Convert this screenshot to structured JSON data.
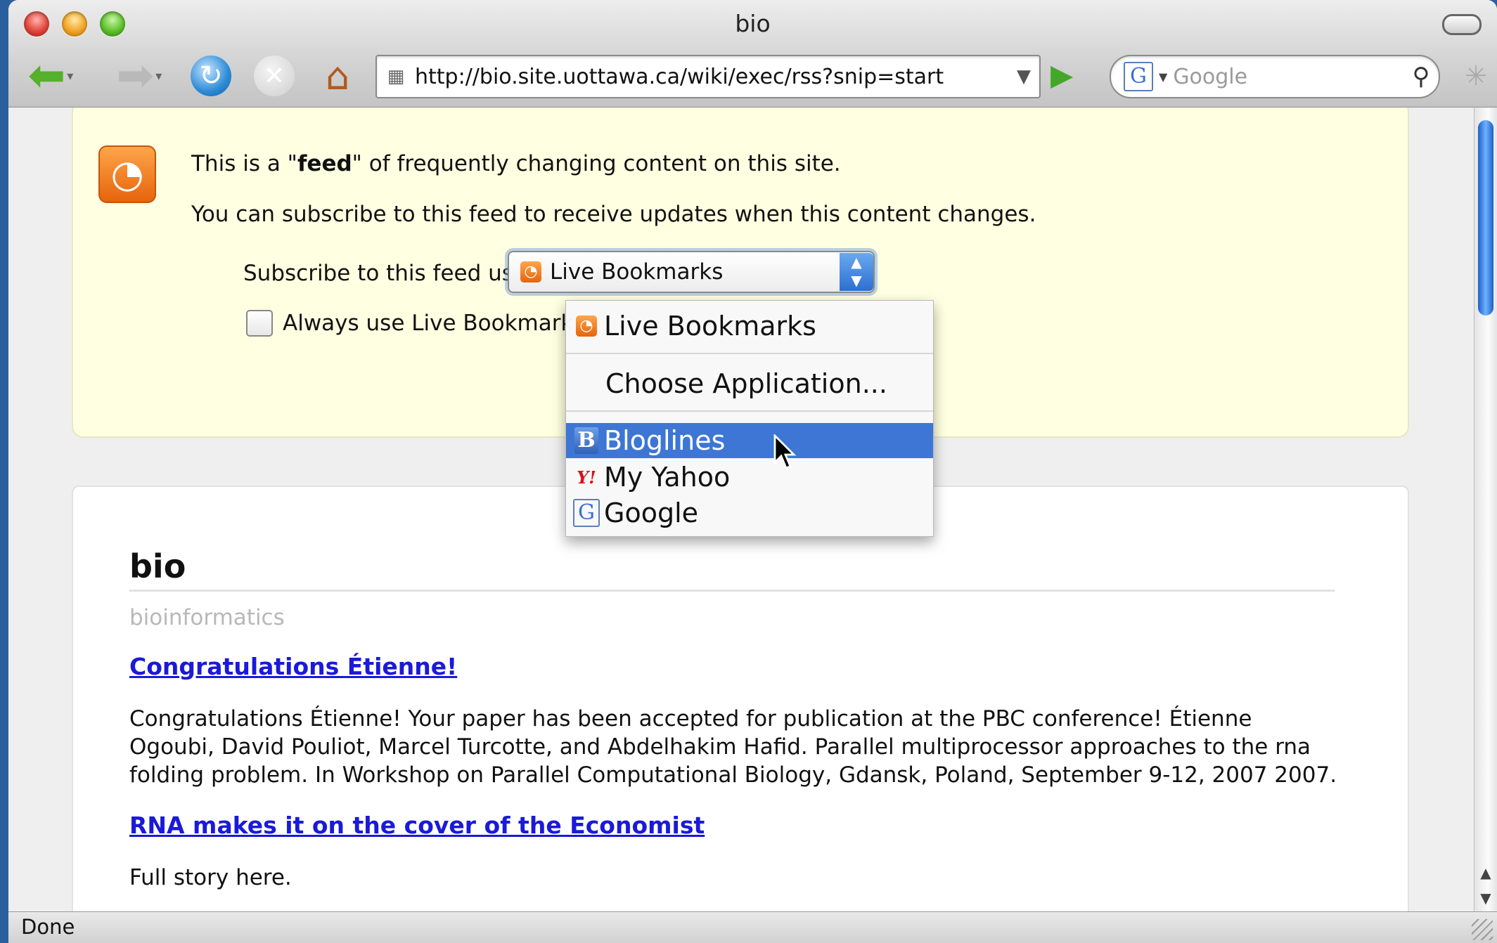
{
  "window": {
    "title": "bio"
  },
  "toolbar": {
    "back_icon": "back-arrow-icon",
    "forward_icon": "forward-arrow-icon",
    "url": "http://bio.site.uottawa.ca/wiki/exec/rss?snip=start",
    "search_engine_letter": "G",
    "search_placeholder": "Google"
  },
  "feed": {
    "line1_pre": "This is a \"",
    "line1_bold": "feed",
    "line1_post": "\" of frequently changing content on this site.",
    "line2": "You can subscribe to this feed to receive updates when this content changes.",
    "subscribe_label": "Subscribe to this feed using",
    "selected_reader": "Live Bookmarks",
    "always_use_label": "Always use Live Bookmark",
    "always_use_checked": false
  },
  "dropdown": {
    "options": [
      {
        "label": "Live Bookmarks",
        "icon": "rss-icon"
      },
      {
        "label": "Choose Application...",
        "icon": ""
      },
      {
        "label": "Bloglines",
        "icon": "bloglines-icon",
        "highlighted": true
      },
      {
        "label": "My Yahoo",
        "icon": "yahoo-icon"
      },
      {
        "label": "Google",
        "icon": "google-icon"
      }
    ]
  },
  "article": {
    "site_title": "bio",
    "site_subtitle": "bioinformatics",
    "entries": [
      {
        "title": "Congratulations Étienne!",
        "body": "Congratulations Étienne! Your paper has been accepted for publication at the PBC conference! Étienne Ogoubi, David Pouliot, Marcel Turcotte, and Abdelhakim Hafid. Parallel multiprocessor approaches to the rna folding problem. In Workshop on Parallel Computational Biology, Gdansk, Poland, September 9-12, 2007 2007."
      },
      {
        "title": "RNA makes it on the cover of the Economist",
        "body": "Full story here."
      }
    ]
  },
  "status": {
    "text": "Done"
  },
  "colors": {
    "feed_background": "#ffffe1",
    "highlight": "#3d76d4",
    "link": "#1a1ad8"
  }
}
